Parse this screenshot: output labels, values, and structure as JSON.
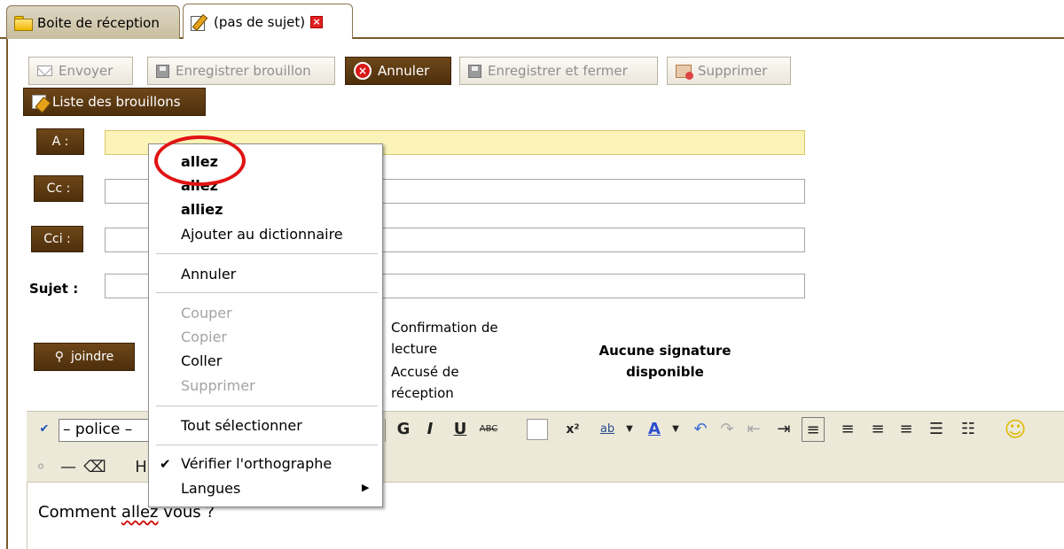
{
  "tabs": [
    {
      "label": "Boite de réception",
      "icon": "folder-icon"
    },
    {
      "label": "(pas de sujet)",
      "icon": "compose-icon",
      "close_icon": "close-icon",
      "active": true
    }
  ],
  "toolbar": {
    "send": "Envoyer",
    "save_draft": "Enregistrer brouillon",
    "cancel": "Annuler",
    "save_close": "Enregistrer et fermer",
    "delete": "Supprimer",
    "drafts_list": "Liste des brouillons"
  },
  "form": {
    "to_label": "A :",
    "cc_label": "Cc :",
    "bcc_label": "Cci :",
    "subject_label": "Sujet :",
    "attach_label": "joindre",
    "read_confirm": "Confirmation de lecture",
    "delivery_receipt": "Accusé de réception",
    "no_signature": "Aucune signature disponible"
  },
  "editor": {
    "font_select": "– police –",
    "heading_fragment": "H",
    "text_before": "Comment ",
    "misspelled_word": "allez",
    "text_after": " vous ?"
  },
  "context_menu": {
    "suggestions": [
      "allez",
      "allez",
      "alliez"
    ],
    "add_to_dictionary": "Ajouter au dictionnaire",
    "undo": "Annuler",
    "cut": "Couper",
    "copy": "Copier",
    "paste": "Coller",
    "delete": "Supprimer",
    "select_all": "Tout sélectionner",
    "check_spelling": "Vérifier l'orthographe",
    "languages": "Langues"
  },
  "colors": {
    "accent_brown": "#5c3a12",
    "to_field_bg": "#fbf3b7",
    "highlight_red": "#e11313",
    "toolbar_bg": "#ece9d8"
  }
}
